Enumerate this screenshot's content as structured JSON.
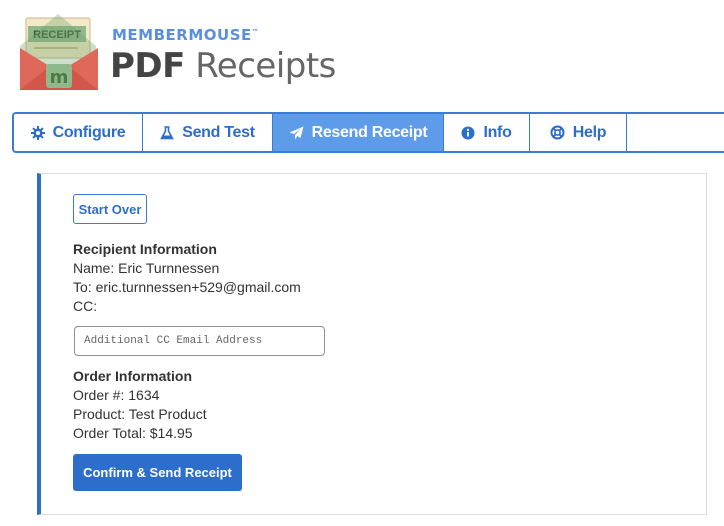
{
  "header": {
    "logo_badge": "RECEIPT",
    "brand_name": "MEMBERMOUSE",
    "brand_mark": "™",
    "title_bold": "PDF",
    "title_light": "Receipts"
  },
  "tabs": [
    {
      "label": "Configure",
      "icon": "gear-icon",
      "active": false
    },
    {
      "label": "Send Test",
      "icon": "flask-icon",
      "active": false
    },
    {
      "label": "Resend Receipt",
      "icon": "paper-plane-icon",
      "active": true
    },
    {
      "label": "Info",
      "icon": "info-circle-icon",
      "active": false
    },
    {
      "label": "Help",
      "icon": "life-ring-icon",
      "active": false
    }
  ],
  "panel": {
    "start_over_label": "Start Over",
    "recipient": {
      "heading": "Recipient Information",
      "name": "Name: Eric Turnnessen",
      "to": "To: eric.turnnessen+529@gmail.com",
      "cc": "CC:"
    },
    "cc_input": {
      "placeholder": "Additional CC Email Address",
      "value": ""
    },
    "order": {
      "heading": "Order Information",
      "number": "Order #: 1634",
      "product": "Product: Test Product",
      "total": "Order Total: $14.95"
    },
    "confirm_label": "Confirm & Send Receipt"
  },
  "colors": {
    "accent": "#2c6ec9",
    "tab_active_bg": "#5e9be8",
    "logo_green": "#8fb98a",
    "logo_red": "#e0685a",
    "brand_blue": "#5a8fd9"
  }
}
